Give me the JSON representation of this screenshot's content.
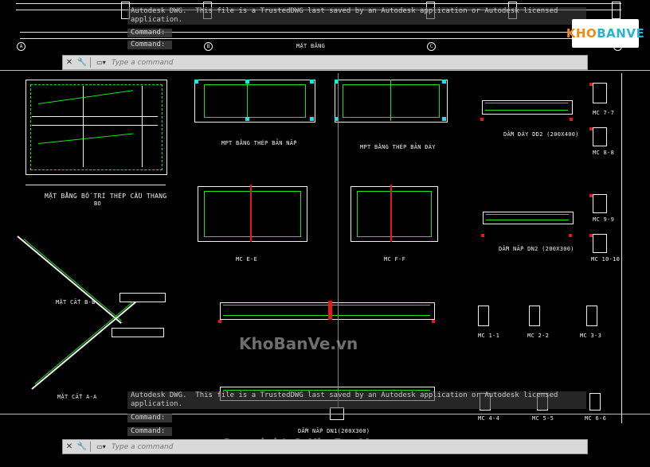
{
  "message_top": "Autodesk DWG.  This file is a TrustedDWG last saved by an Autodesk application or Autodesk licensed application.",
  "message_bottom": "Autodesk DWG.  This file is a TrustedDWG last saved by an Autodesk application or Autodesk licensed application.",
  "command_history_label": "Command:",
  "command_placeholder": "Type a command",
  "logo": {
    "part1": "KHO",
    "part2": "BANVE"
  },
  "watermarks": {
    "center": "KhoBanVe.vn",
    "bottom": "Copyright © KhoBanVe.vn"
  },
  "colors": {
    "accent_green": "#19e619",
    "drawing_white": "#f0f0f0",
    "highlight_red": "#e61919",
    "cyan": "#19e6e6",
    "yellow": "#f2e600",
    "logo_orange": "#f08a1c",
    "logo_cyan": "#2bb3c9"
  },
  "icons": {
    "close": "close-icon",
    "customize": "wrench-icon",
    "prompt": "command-prompt-icon"
  },
  "top_grid": {
    "labels": [
      "A",
      "B",
      "C",
      "D"
    ],
    "section_title": "MẶT BẰNG"
  },
  "drawing_titles": {
    "stair_plan": "MẶT BẰNG BỐ TRÍ THÉP CẦU THANG",
    "stair_plan_sub": "BO",
    "floor_plan_1": "MPT BẰNG THÉP BẢN NẮP",
    "floor_plan_2": "MPT BẰNG THÉP BẢN ĐÁY",
    "beam_dd2": "DẦM ĐÁY DD2 (200X400)",
    "beam_dn2": "DẦM NẮP DN2 (200X300)",
    "beam_dn1": "DẦM NẮP DN1(200X300)",
    "section_ee": "MC E-E",
    "section_ff": "MC F-F",
    "section_bb": "MẶT CẮT B-B",
    "section_aa": "MẶT CẮT A-A",
    "mc_77": "MC 7-7",
    "mc_88": "MC 8-8",
    "mc_99": "MC 9-9",
    "mc_1010": "MC 10-10",
    "mc_11": "MC 1-1",
    "mc_22": "MC 2-2",
    "mc_33": "MC 3-3",
    "mc_44": "MC 4-4",
    "mc_55": "MC 5-5",
    "mc_66": "MC 6-6"
  }
}
